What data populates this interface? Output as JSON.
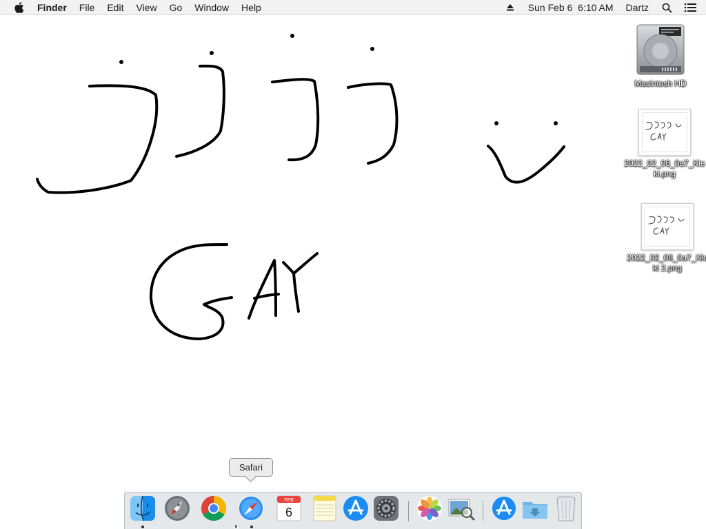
{
  "menubar": {
    "apple_icon": "apple-icon",
    "app_name": "Finder",
    "menus": [
      "File",
      "Edit",
      "View",
      "Go",
      "Window",
      "Help"
    ],
    "eject_icon": "eject-icon",
    "datetime": "Sun Feb 6  6:10 AM",
    "user": "Dartz",
    "search_icon": "spotlight-search-icon",
    "notifications_icon": "notification-center-icon"
  },
  "drawing": {
    "text_marks": [
      "ɔ",
      "ɔ",
      "ɔ",
      "ɔ"
    ],
    "word": "GAY",
    "stroke_color": "#000000"
  },
  "desktop": {
    "icons": [
      {
        "label": "Macintosh HD",
        "icon": "hard-drive-icon"
      },
      {
        "label": "2022_02_06_0a7_Kleki.png",
        "icon": "image-file-icon"
      },
      {
        "label": "2022_02_06_0a7_Kleki 2.png",
        "icon": "image-file-icon"
      }
    ]
  },
  "dock": {
    "tooltip": "Safari",
    "items": [
      {
        "name": "Finder",
        "icon": "finder-icon",
        "running": true
      },
      {
        "name": "Launchpad",
        "icon": "launchpad-icon",
        "running": false
      },
      {
        "name": "Google Chrome",
        "icon": "chrome-icon",
        "running": false
      },
      {
        "name": "Safari",
        "icon": "safari-icon",
        "running": true
      },
      {
        "name": "Calendar",
        "icon": "calendar-icon",
        "running": false,
        "month": "FEB",
        "day": "6"
      },
      {
        "name": "Notes",
        "icon": "notes-icon",
        "running": false
      },
      {
        "name": "App Store",
        "icon": "app-store-icon",
        "running": false
      },
      {
        "name": "System Preferences",
        "icon": "system-preferences-icon",
        "running": false
      },
      {
        "name": "Photos",
        "icon": "photos-icon",
        "running": false
      },
      {
        "name": "Preview",
        "icon": "preview-icon",
        "running": false
      },
      {
        "name": "Applications",
        "icon": "applications-folder-icon",
        "running": false
      },
      {
        "name": "Downloads",
        "icon": "downloads-folder-icon",
        "running": false
      },
      {
        "name": "Trash",
        "icon": "trash-icon",
        "running": false
      }
    ]
  }
}
